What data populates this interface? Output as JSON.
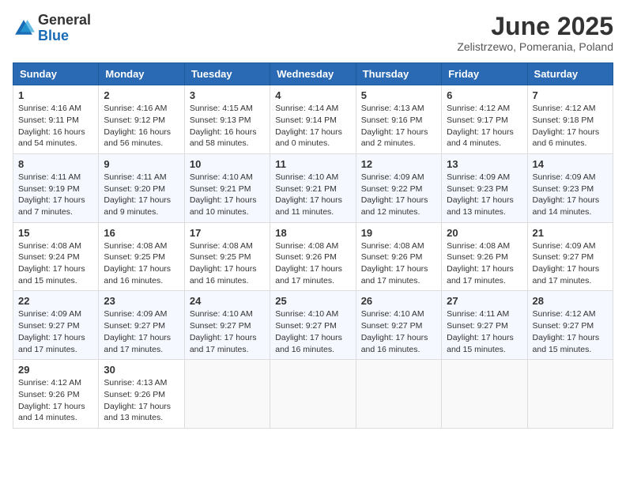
{
  "header": {
    "logo": {
      "general": "General",
      "blue": "Blue"
    },
    "title": "June 2025",
    "location": "Zelistrzewo, Pomerania, Poland"
  },
  "calendar": {
    "columns": [
      "Sunday",
      "Monday",
      "Tuesday",
      "Wednesday",
      "Thursday",
      "Friday",
      "Saturday"
    ],
    "weeks": [
      [
        null,
        {
          "day": "2",
          "sunrise": "4:16 AM",
          "sunset": "9:12 PM",
          "daylight": "16 hours and 56 minutes."
        },
        {
          "day": "3",
          "sunrise": "4:15 AM",
          "sunset": "9:13 PM",
          "daylight": "16 hours and 58 minutes."
        },
        {
          "day": "4",
          "sunrise": "4:14 AM",
          "sunset": "9:14 PM",
          "daylight": "17 hours and 0 minutes."
        },
        {
          "day": "5",
          "sunrise": "4:13 AM",
          "sunset": "9:16 PM",
          "daylight": "17 hours and 2 minutes."
        },
        {
          "day": "6",
          "sunrise": "4:12 AM",
          "sunset": "9:17 PM",
          "daylight": "17 hours and 4 minutes."
        },
        {
          "day": "7",
          "sunrise": "4:12 AM",
          "sunset": "9:18 PM",
          "daylight": "17 hours and 6 minutes."
        }
      ],
      [
        {
          "day": "1",
          "sunrise": "4:16 AM",
          "sunset": "9:11 PM",
          "daylight": "16 hours and 54 minutes."
        },
        {
          "day": "9",
          "sunrise": "4:11 AM",
          "sunset": "9:20 PM",
          "daylight": "17 hours and 9 minutes."
        },
        {
          "day": "10",
          "sunrise": "4:10 AM",
          "sunset": "9:21 PM",
          "daylight": "17 hours and 10 minutes."
        },
        {
          "day": "11",
          "sunrise": "4:10 AM",
          "sunset": "9:21 PM",
          "daylight": "17 hours and 11 minutes."
        },
        {
          "day": "12",
          "sunrise": "4:09 AM",
          "sunset": "9:22 PM",
          "daylight": "17 hours and 12 minutes."
        },
        {
          "day": "13",
          "sunrise": "4:09 AM",
          "sunset": "9:23 PM",
          "daylight": "17 hours and 13 minutes."
        },
        {
          "day": "14",
          "sunrise": "4:09 AM",
          "sunset": "9:23 PM",
          "daylight": "17 hours and 14 minutes."
        }
      ],
      [
        {
          "day": "8",
          "sunrise": "4:11 AM",
          "sunset": "9:19 PM",
          "daylight": "17 hours and 7 minutes."
        },
        {
          "day": "16",
          "sunrise": "4:08 AM",
          "sunset": "9:25 PM",
          "daylight": "17 hours and 16 minutes."
        },
        {
          "day": "17",
          "sunrise": "4:08 AM",
          "sunset": "9:25 PM",
          "daylight": "17 hours and 16 minutes."
        },
        {
          "day": "18",
          "sunrise": "4:08 AM",
          "sunset": "9:26 PM",
          "daylight": "17 hours and 17 minutes."
        },
        {
          "day": "19",
          "sunrise": "4:08 AM",
          "sunset": "9:26 PM",
          "daylight": "17 hours and 17 minutes."
        },
        {
          "day": "20",
          "sunrise": "4:08 AM",
          "sunset": "9:26 PM",
          "daylight": "17 hours and 17 minutes."
        },
        {
          "day": "21",
          "sunrise": "4:09 AM",
          "sunset": "9:27 PM",
          "daylight": "17 hours and 17 minutes."
        }
      ],
      [
        {
          "day": "15",
          "sunrise": "4:08 AM",
          "sunset": "9:24 PM",
          "daylight": "17 hours and 15 minutes."
        },
        {
          "day": "23",
          "sunrise": "4:09 AM",
          "sunset": "9:27 PM",
          "daylight": "17 hours and 17 minutes."
        },
        {
          "day": "24",
          "sunrise": "4:10 AM",
          "sunset": "9:27 PM",
          "daylight": "17 hours and 17 minutes."
        },
        {
          "day": "25",
          "sunrise": "4:10 AM",
          "sunset": "9:27 PM",
          "daylight": "17 hours and 16 minutes."
        },
        {
          "day": "26",
          "sunrise": "4:10 AM",
          "sunset": "9:27 PM",
          "daylight": "17 hours and 16 minutes."
        },
        {
          "day": "27",
          "sunrise": "4:11 AM",
          "sunset": "9:27 PM",
          "daylight": "17 hours and 15 minutes."
        },
        {
          "day": "28",
          "sunrise": "4:12 AM",
          "sunset": "9:27 PM",
          "daylight": "17 hours and 15 minutes."
        }
      ],
      [
        {
          "day": "22",
          "sunrise": "4:09 AM",
          "sunset": "9:27 PM",
          "daylight": "17 hours and 17 minutes."
        },
        {
          "day": "30",
          "sunrise": "4:13 AM",
          "sunset": "9:26 PM",
          "daylight": "17 hours and 13 minutes."
        },
        null,
        null,
        null,
        null,
        null
      ],
      [
        {
          "day": "29",
          "sunrise": "4:12 AM",
          "sunset": "9:26 PM",
          "daylight": "17 hours and 14 minutes."
        },
        null,
        null,
        null,
        null,
        null,
        null
      ]
    ]
  }
}
